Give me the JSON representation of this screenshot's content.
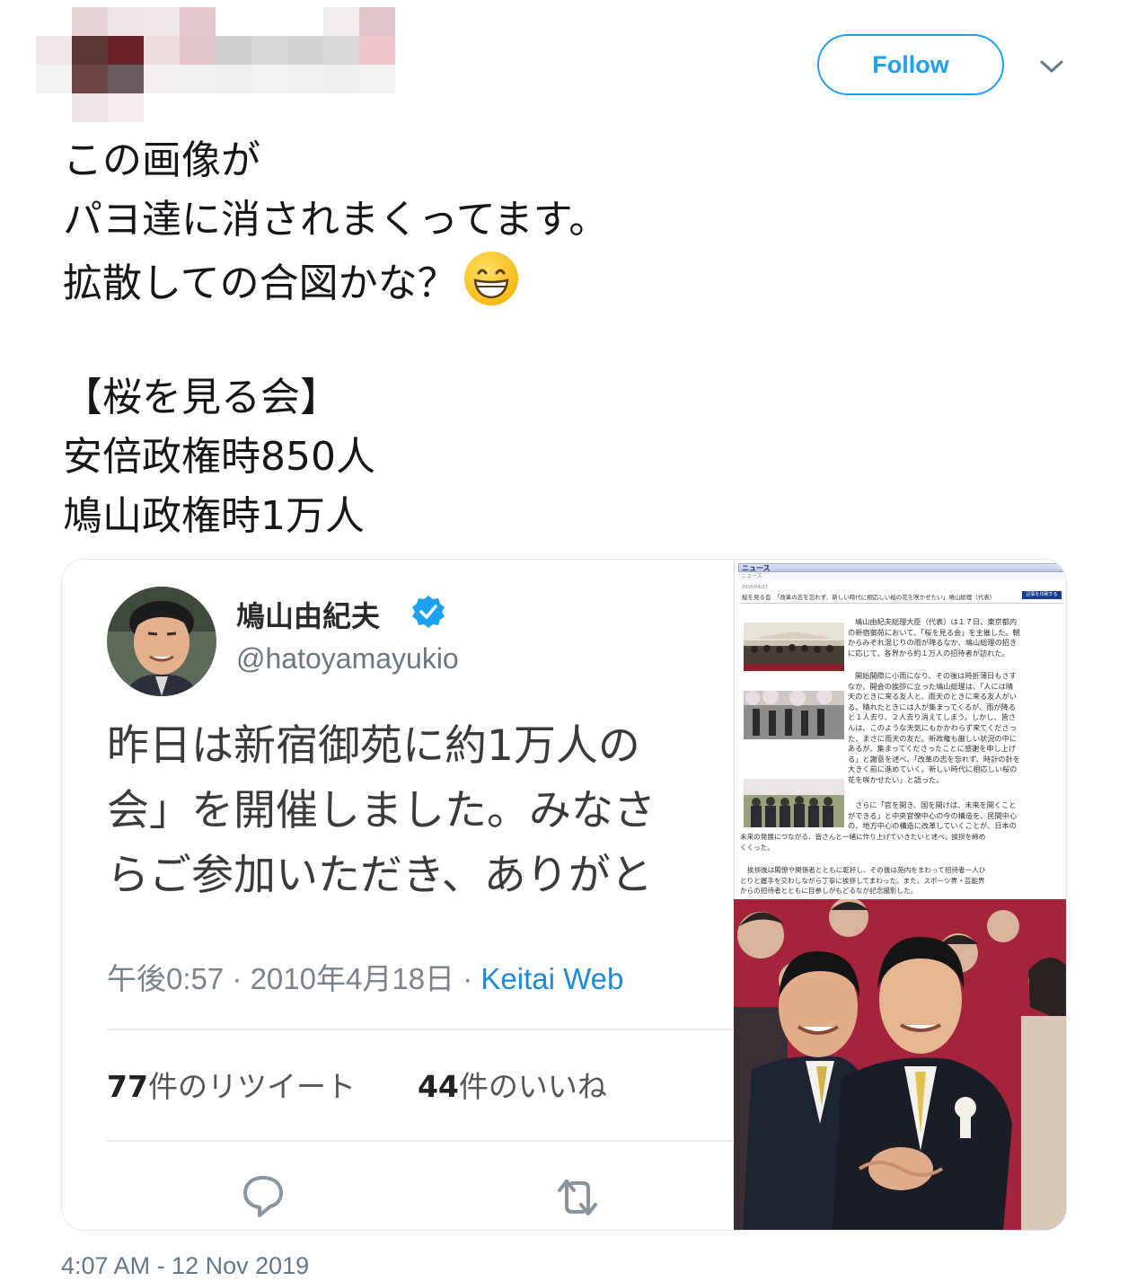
{
  "header": {
    "follow_label": "Follow",
    "follow_color": "#1da1f2",
    "caret_icon": "chevron-down-icon"
  },
  "tweet": {
    "lines": [
      "この画像が",
      "パヨ達に消されまくってます。",
      "拡散しての合図かな？",
      "",
      "【桜を見る会】",
      "安倍政権時850人",
      "鳩山政権時1万人"
    ],
    "emoji": "grinning-face-emoji",
    "timestamp": "4:07 AM - 12 Nov 2019"
  },
  "embedded_card": {
    "name": "鳩山由紀夫",
    "handle": "@hatoyamayukio",
    "body_lines": [
      "昨日は新宿御苑に約1万人の",
      "会」を開催しました。みなさ",
      "らご参加いただき、ありがと"
    ],
    "time": "午後0:57",
    "date": "2010年4月18日",
    "source": "Keitai Web",
    "retweet_count": "77",
    "retweet_label": "件のリツイート",
    "like_count": "44",
    "like_label": "件のいいね",
    "link_color": "#1d8ad8"
  },
  "news_page": {
    "header": "ニュース",
    "sub": "ニュース",
    "date": "2010/04/17",
    "title": "桜を見る会　「改革の志を忘れず、新しい時代に相応しい桜の花を咲かせたい」鳩山総理（代表）",
    "button": "記事を印刷する",
    "p1_lines": [
      "鳩山由紀夫総理大臣（代表）は１７日、東京都内",
      "の新宿御苑において、「桜を見る会」を主催した。朝",
      "からみぞれ混じりの雨が降るなか、鳩山総理の招き",
      "に応じて、各界から約１万人の招待者が訪れた。"
    ],
    "p2_lines": [
      "開始間際に小雨になり、その後は時折薄日もさす",
      "なか、開会の挨拶に立った鳩山総理は、「人には晴",
      "天のときに来る友人と、雨天のときに来る友人がい",
      "る。晴れたときには人が集まってくるが、雨が降る",
      "と１人去り、２人去り消えてしまう。しかし、皆さ",
      "んは、このような天気にもかかわらず来てくださっ",
      "た、まさに雨天の友だ。新政権も厳しい状況の中に",
      "あるが、集まってくださったことに感謝を申し上げ",
      "る」と謝意を述べ、「改革の志を忘れず、時計の針を",
      "大きく前に進めていく。新しい時代に相応しい桜の",
      "花を咲かせたい」と語った。"
    ],
    "p3_lines": [
      "さらに「官を開き、国を開けば、未来を開くこと",
      "ができる」と中央官僚中心の今の構造を、民間中心",
      "の、地方中心の構造に改革していくことが、日本の",
      "未来の発展につながる、皆さんと一緒に作り上げていきたいと述べ、挨拶を締め",
      "くくった。"
    ],
    "p4_lines": [
      "挨拶後は閣僚や関係者とともに乾杯し、その後は苑内をまわって招待者一人ひ",
      "とりと握手を交わしながら丁寧に挨拶してまわった。また、スポーツ界・芸能界",
      "からの招待者とともに目参しがもどるなか記念撮影した。"
    ]
  }
}
